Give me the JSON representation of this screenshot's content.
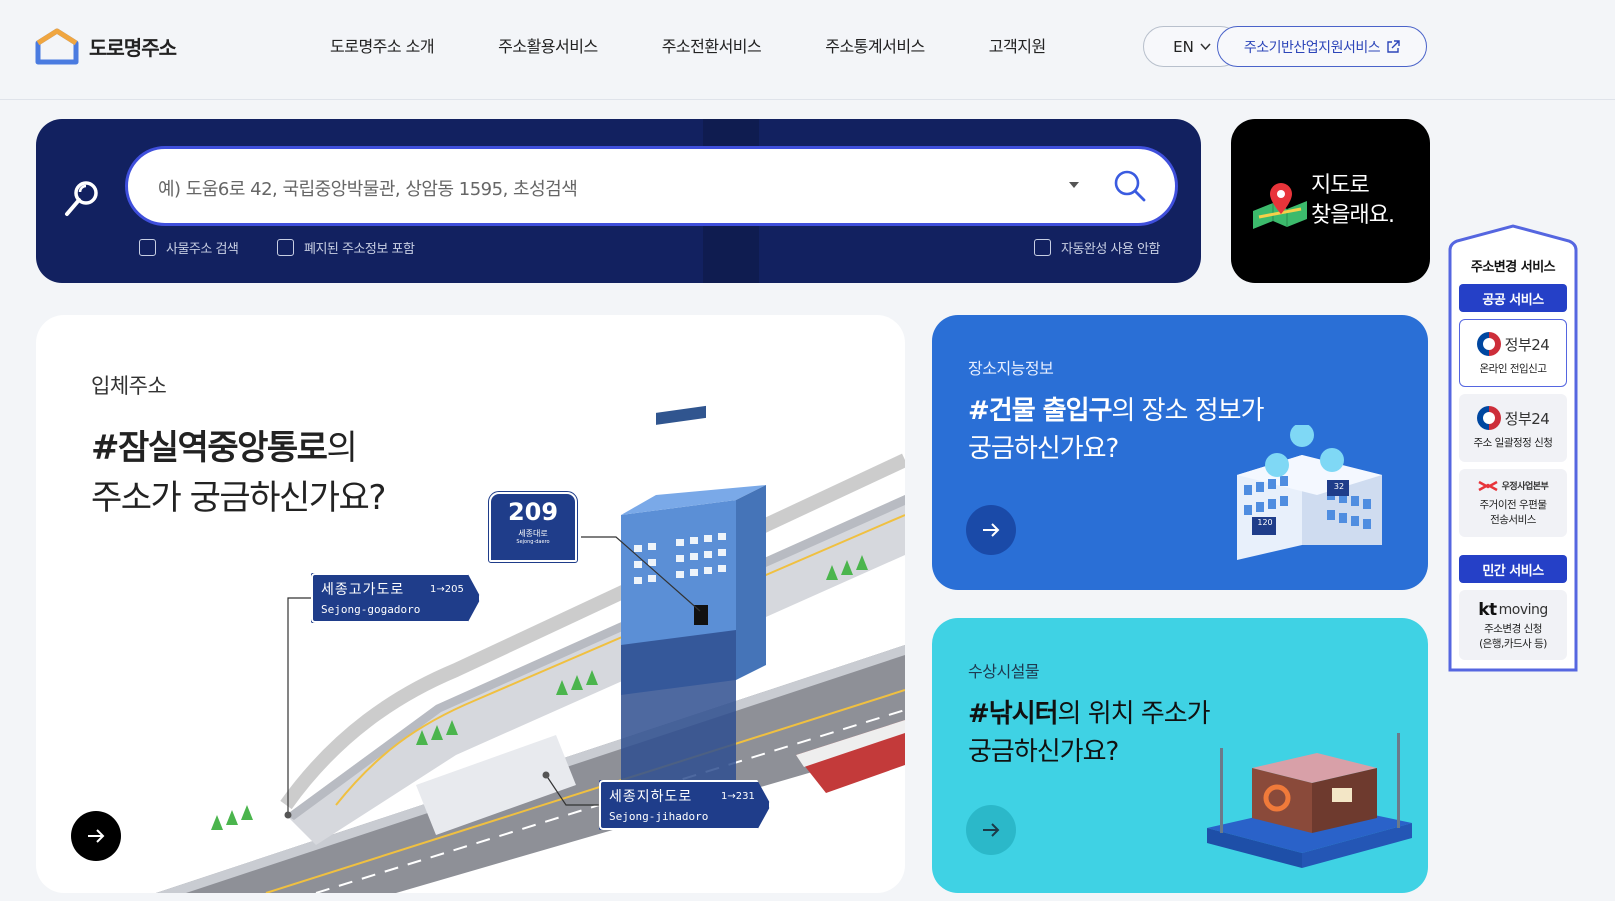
{
  "header": {
    "logo_text": "도로명주소",
    "nav": [
      "도로명주소 소개",
      "주소활용서비스",
      "주소전환서비스",
      "주소통계서비스",
      "고객지원"
    ],
    "lang": "EN",
    "industry_button": "주소기반산업지원서비스"
  },
  "search": {
    "placeholder": "예) 도움6로 42, 국립중앙박물관, 상암동 1595, 초성검색",
    "checkbox_things": "사물주소 검색",
    "checkbox_abolished": "폐지된 주소정보 포함",
    "checkbox_autocomplete": "자동완성 사용 안함"
  },
  "map_button": {
    "line1": "지도로",
    "line2": "찾을래요."
  },
  "main_card": {
    "subtitle": "입체주소",
    "title_bold": "#잠실역중앙통로",
    "title_rest": "의",
    "title_line2": "주소가 궁금하신가요?",
    "sign_building_number": "209",
    "sign_building_kor": "세종대로",
    "sign_building_eng": "Sejong-daero",
    "sign_elevated_kor": "세종고가도로",
    "sign_elevated_range": "1→205",
    "sign_elevated_eng": "Sejong-gogadoro",
    "sign_underpass_kor": "세종지하도로",
    "sign_underpass_range": "1→231",
    "sign_underpass_eng": "Sejong-jihadoro"
  },
  "blue_card": {
    "subtitle": "장소지능정보",
    "title_bold": "#건물 출입구",
    "title_rest": "의 장소 정보가",
    "title_line2": "궁금하신가요?",
    "plate_a": "120",
    "plate_b": "32"
  },
  "cyan_card": {
    "subtitle": "수상시설물",
    "title_bold": "#낚시터",
    "title_rest": "의 위치 주소가",
    "title_line2": "궁금하신가요?"
  },
  "side_panel": {
    "title": "주소변경 서비스",
    "public_label": "공공 서비스",
    "items_public": [
      {
        "brand": "정부24",
        "desc": "온라인 전입신고"
      },
      {
        "brand": "정부24",
        "desc": "주소 일괄정정 신청"
      },
      {
        "brand": "우정사업본부",
        "desc_line1": "주거이전 우편물",
        "desc_line2": "전송서비스"
      }
    ],
    "private_label": "민간 서비스",
    "item_private": {
      "brand_kt": "kt",
      "brand_rest": "moving",
      "desc_line1": "주소변경 신청",
      "desc_line2": "(은행,카드사 등)"
    }
  },
  "colors": {
    "navy": "#122160",
    "accent_blue": "#2a6fd6",
    "cyan": "#3fd2e4",
    "button_blue": "#2540c7"
  }
}
